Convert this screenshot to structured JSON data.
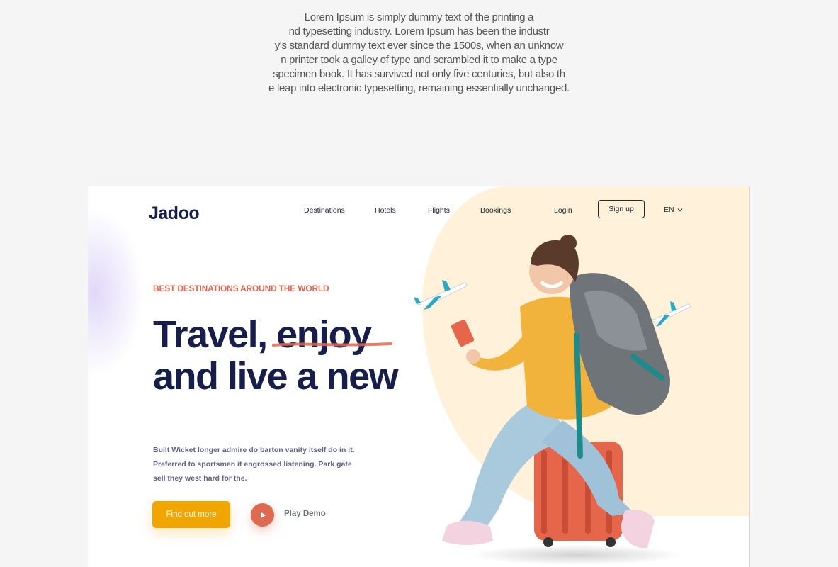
{
  "intro": {
    "lines": [
      "Lorem Ipsum is simply dummy text of the printing a",
      "nd typesetting industry. Lorem Ipsum has been the industr",
      "y's standard dummy text ever since the 1500s, when an unknow",
      "n printer took a galley of type and scrambled it to make a type",
      "specimen book. It has survived not only five centuries, but also th",
      "e leap into electronic typesetting, remaining essentially unchanged."
    ]
  },
  "site": {
    "logo": "Jadoo",
    "nav": {
      "destinations": "Destinations",
      "hotels": "Hotels",
      "flights": "Flights",
      "bookings": "Bookings",
      "login": "Login",
      "signup": "Sign up",
      "language": "EN"
    },
    "hero": {
      "tagline": "BEST DESTINATIONS AROUND THE WORLD",
      "headline_line1": "Travel, enjoy",
      "headline_line2": "and live a new",
      "description": [
        "Built Wicket longer admire do barton vanity itself do in it.",
        "Preferred to sportsmen it engrossed listening. Park gate",
        "sell they west hard for the."
      ],
      "cta_label": "Find out more",
      "play_label": "Play Demo"
    }
  },
  "colors": {
    "navy": "#181e4b",
    "accent_orange": "#df6951",
    "cta_yellow": "#f1a501",
    "peach": "#fff1da"
  },
  "icons": {
    "play": "play-icon",
    "chevron": "chevron-down-icon",
    "plane": "airplane-icon"
  }
}
